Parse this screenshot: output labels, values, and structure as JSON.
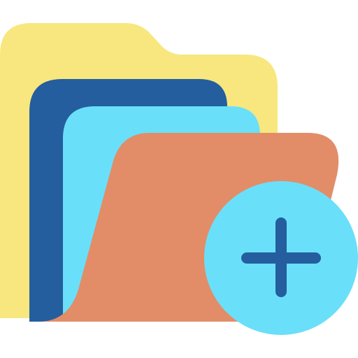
{
  "icon": {
    "name": "add-folder-icon",
    "parts": {
      "back_folder": "folder-back-icon",
      "dark_sheet": "document-sheet-icon",
      "light_sheet": "document-sheet-icon",
      "front_flap": "folder-front-icon",
      "badge": "plus-circle-icon"
    },
    "colors": {
      "background": "#ffffff",
      "folder_back": "#F7E77E",
      "sheet_dark": "#245E9F",
      "sheet_light": "#6ADFF9",
      "folder_front": "#E28D68",
      "badge_fill": "#6ADFF9",
      "plus_stroke": "#245E9F"
    }
  }
}
